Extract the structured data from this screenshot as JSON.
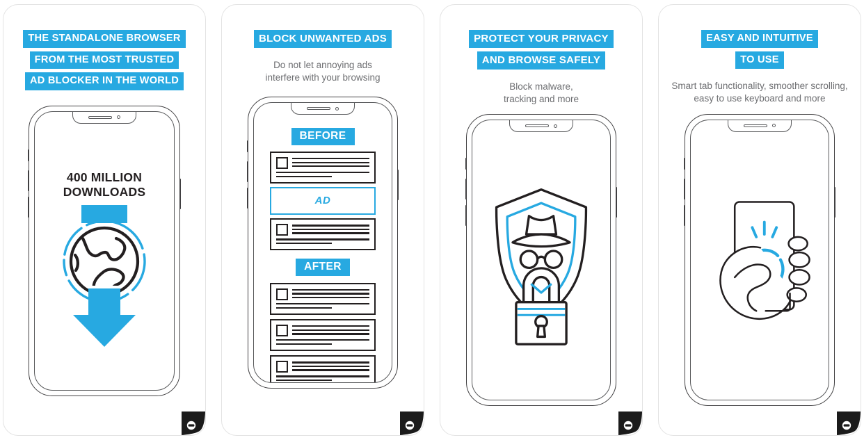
{
  "brand": {
    "accent_blue": "#27a9e1",
    "ink": "#231f20",
    "body_gray": "#6d6e71",
    "badge_logo_name": "adblock-logo"
  },
  "panels": [
    {
      "id": "panel-downloads",
      "headline_lines": [
        "THE STANDALONE BROWSER",
        "FROM THE MOST TRUSTED",
        "AD BLOCKER IN THE WORLD"
      ],
      "subcopy": "",
      "screen": {
        "kind": "downloads",
        "title": "400 MILLION\nDOWNLOADS",
        "illustration": "globe-with-download-arrow"
      }
    },
    {
      "id": "panel-block-ads",
      "headline_lines": [
        "BLOCK UNWANTED ADS"
      ],
      "subcopy": "Do not let annoying ads\ninterfere with your browsing",
      "screen": {
        "kind": "before-after",
        "before_label": "BEFORE",
        "after_label": "AFTER",
        "ad_label": "AD",
        "before_cards": 2,
        "after_cards": 3,
        "illustration": "content-cards-with-ad-slot"
      }
    },
    {
      "id": "panel-privacy",
      "headline_lines": [
        "PROTECT YOUR PRIVACY",
        "AND BROWSE SAFELY"
      ],
      "subcopy": "Block malware,\ntracking and more",
      "screen": {
        "kind": "art",
        "illustration": "shield-incognito-padlock"
      }
    },
    {
      "id": "panel-easy",
      "headline_lines": [
        "EASY AND INTUITIVE",
        "TO USE"
      ],
      "subcopy": "Smart tab functionality, smoother scrolling,\neasy to use keyboard and more",
      "screen": {
        "kind": "art",
        "illustration": "hand-tapping-phone"
      }
    }
  ]
}
